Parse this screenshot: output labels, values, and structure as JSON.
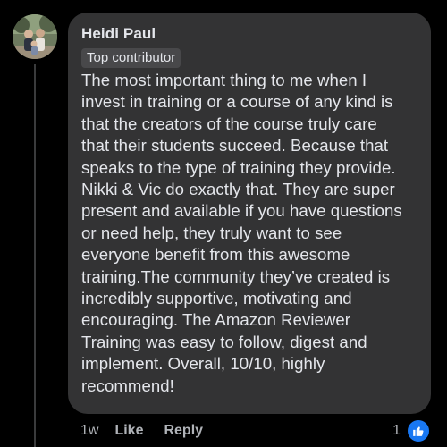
{
  "comment": {
    "author": "Heidi Paul",
    "badge": "Top contributor",
    "text_lines": [
      "The most important thing to me when I",
      "invest in training or a course of any kind is",
      "that the creators of the course truly care",
      "that their students succeed. Because that",
      "speaks to the type of training they provide.",
      "Nikki & Vic do exactly that. They are super",
      "present and available if you have questions",
      "or need help, they truly want to see",
      "everyone benefit from this awesome",
      "training.The community they’ve created is",
      "incredibly supportive, motivating and",
      "encouraging. The Amazon Reviewer",
      "Training was easy to follow, digest and",
      "implement. Overall, 10/10, highly",
      "recommend!"
    ]
  },
  "footer": {
    "time": "1w",
    "like_label": "Like",
    "reply_label": "Reply",
    "reaction_count": "1",
    "reaction_icon": "thumbs-up-icon"
  },
  "colors": {
    "background": "#000000",
    "bubble": "#333334",
    "text": "#e4e6eb",
    "muted": "#b0b3b8",
    "like_blue": "#1877f2"
  }
}
